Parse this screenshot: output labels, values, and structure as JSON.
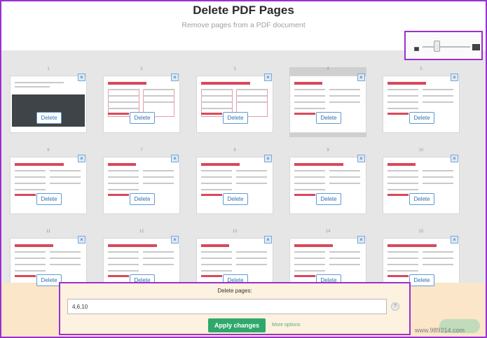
{
  "header": {
    "title": "Delete PDF Pages",
    "subtitle": "Remove pages from a PDF document"
  },
  "zoom": {
    "small_icon": "small-image-icon",
    "large_icon": "large-image-icon",
    "level": 0.3
  },
  "pages": [
    {
      "num": "1",
      "delete_label": "Delete",
      "close_label": "×"
    },
    {
      "num": "2",
      "delete_label": "Delete",
      "close_label": "×"
    },
    {
      "num": "3",
      "delete_label": "Delete",
      "close_label": "×"
    },
    {
      "num": "4",
      "delete_label": "Delete",
      "close_label": "×"
    },
    {
      "num": "5",
      "delete_label": "Delete",
      "close_label": "×"
    },
    {
      "num": "6",
      "delete_label": "Delete",
      "close_label": "×"
    },
    {
      "num": "7",
      "delete_label": "Delete",
      "close_label": "×"
    },
    {
      "num": "8",
      "delete_label": "Delete",
      "close_label": "×"
    },
    {
      "num": "9",
      "delete_label": "Delete",
      "close_label": "×"
    },
    {
      "num": "10",
      "delete_label": "Delete",
      "close_label": "×"
    },
    {
      "num": "11",
      "delete_label": "Delete",
      "close_label": "×"
    },
    {
      "num": "12",
      "delete_label": "Delete",
      "close_label": "×"
    },
    {
      "num": "13",
      "delete_label": "Delete",
      "close_label": "×"
    },
    {
      "num": "14",
      "delete_label": "Delete",
      "close_label": "×"
    },
    {
      "num": "15",
      "delete_label": "Delete",
      "close_label": "×"
    }
  ],
  "footer": {
    "label": "Delete pages:",
    "input_value": "4,6,10",
    "help_label": "?",
    "apply_label": "Apply changes",
    "more_options": "More options"
  },
  "watermark": "www.989214.com",
  "colors": {
    "accent": "#9b2fd1",
    "apply": "#2fa86b",
    "delete_border": "#5c9bd6"
  }
}
